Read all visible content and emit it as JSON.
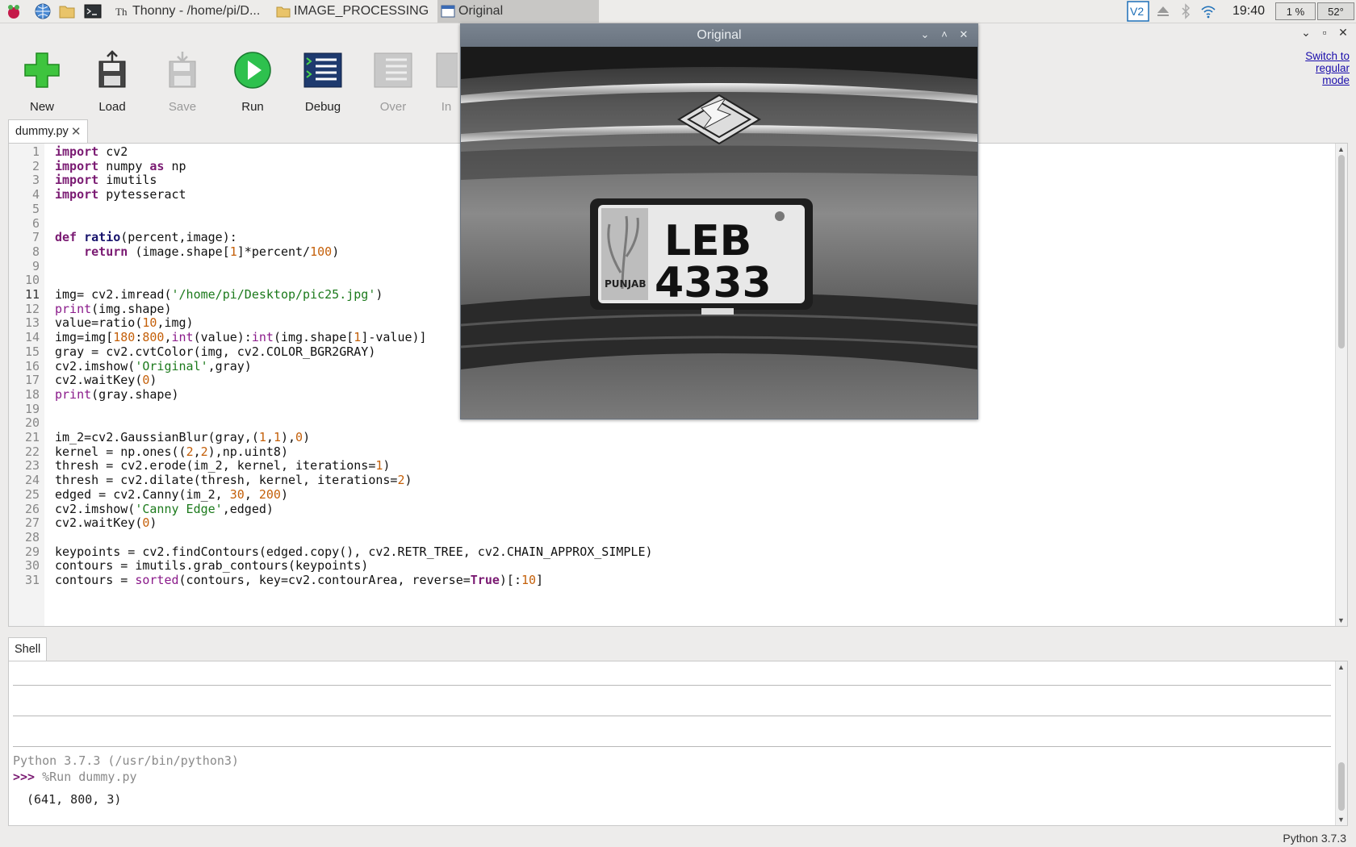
{
  "taskbar": {
    "tasks": [
      {
        "label": "Thonny  -  /home/pi/D...",
        "icon": "thonny-icon"
      },
      {
        "label": "IMAGE_PROCESSING",
        "icon": "folder-icon"
      },
      {
        "label": "Original",
        "icon": "window-icon"
      }
    ],
    "clock": "19:40",
    "cpu": "1 %",
    "temp": "52°"
  },
  "toolbar": {
    "new_label": "New",
    "load_label": "Load",
    "save_label": "Save",
    "run_label": "Run",
    "debug_label": "Debug",
    "over_label": "Over",
    "into_label": "In"
  },
  "switch_mode": "Switch to regular mode",
  "editor": {
    "tab_label": "dummy.py",
    "current_line": 11,
    "line_numbers": [
      "1",
      "2",
      "3",
      "4",
      "5",
      "6",
      "7",
      "8",
      "9",
      "10",
      "11",
      "12",
      "13",
      "14",
      "15",
      "16",
      "17",
      "18",
      "19",
      "20",
      "21",
      "22",
      "23",
      "24",
      "25",
      "26",
      "27",
      "28",
      "29",
      "30",
      "31"
    ],
    "lines": [
      "import cv2",
      "import numpy as np",
      "import imutils",
      "import pytesseract",
      "",
      "",
      "def ratio(percent,image):",
      "    return (image.shape[1]*percent/100)",
      "",
      "",
      "img= cv2.imread('/home/pi/Desktop/pic25.jpg')",
      "print(img.shape)",
      "value=ratio(10,img)",
      "img=img[180:800,int(value):int(img.shape[1]-value)]",
      "gray = cv2.cvtColor(img, cv2.COLOR_BGR2GRAY)",
      "cv2.imshow('Original',gray)",
      "cv2.waitKey(0)",
      "print(gray.shape)",
      "",
      "",
      "im_2=cv2.GaussianBlur(gray,(1,1),0)",
      "kernel = np.ones((2,2),np.uint8)",
      "thresh = cv2.erode(im_2, kernel, iterations=1)",
      "thresh = cv2.dilate(thresh, kernel, iterations=2)",
      "edged = cv2.Canny(im_2, 30, 200)",
      "cv2.imshow('Canny Edge',edged)",
      "cv2.waitKey(0)",
      "",
      "keypoints = cv2.findContours(edged.copy(), cv2.RETR_TREE, cv2.CHAIN_APPROX_SIMPLE)",
      "contours = imutils.grab_contours(keypoints)",
      "contours = sorted(contours, key=cv2.contourArea, reverse=True)[:10]"
    ]
  },
  "shell": {
    "tab_label": "Shell",
    "version_line": "Python 3.7.3 (/usr/bin/python3)",
    "prompt": ">>>",
    "command": "%Run dummy.py",
    "output": "(641, 800, 3)"
  },
  "status": {
    "interpreter": "Python 3.7.3"
  },
  "image_window": {
    "title": "Original",
    "plate_line1": "LEB",
    "plate_line2": "4333",
    "plate_region": "PUNJAB"
  }
}
